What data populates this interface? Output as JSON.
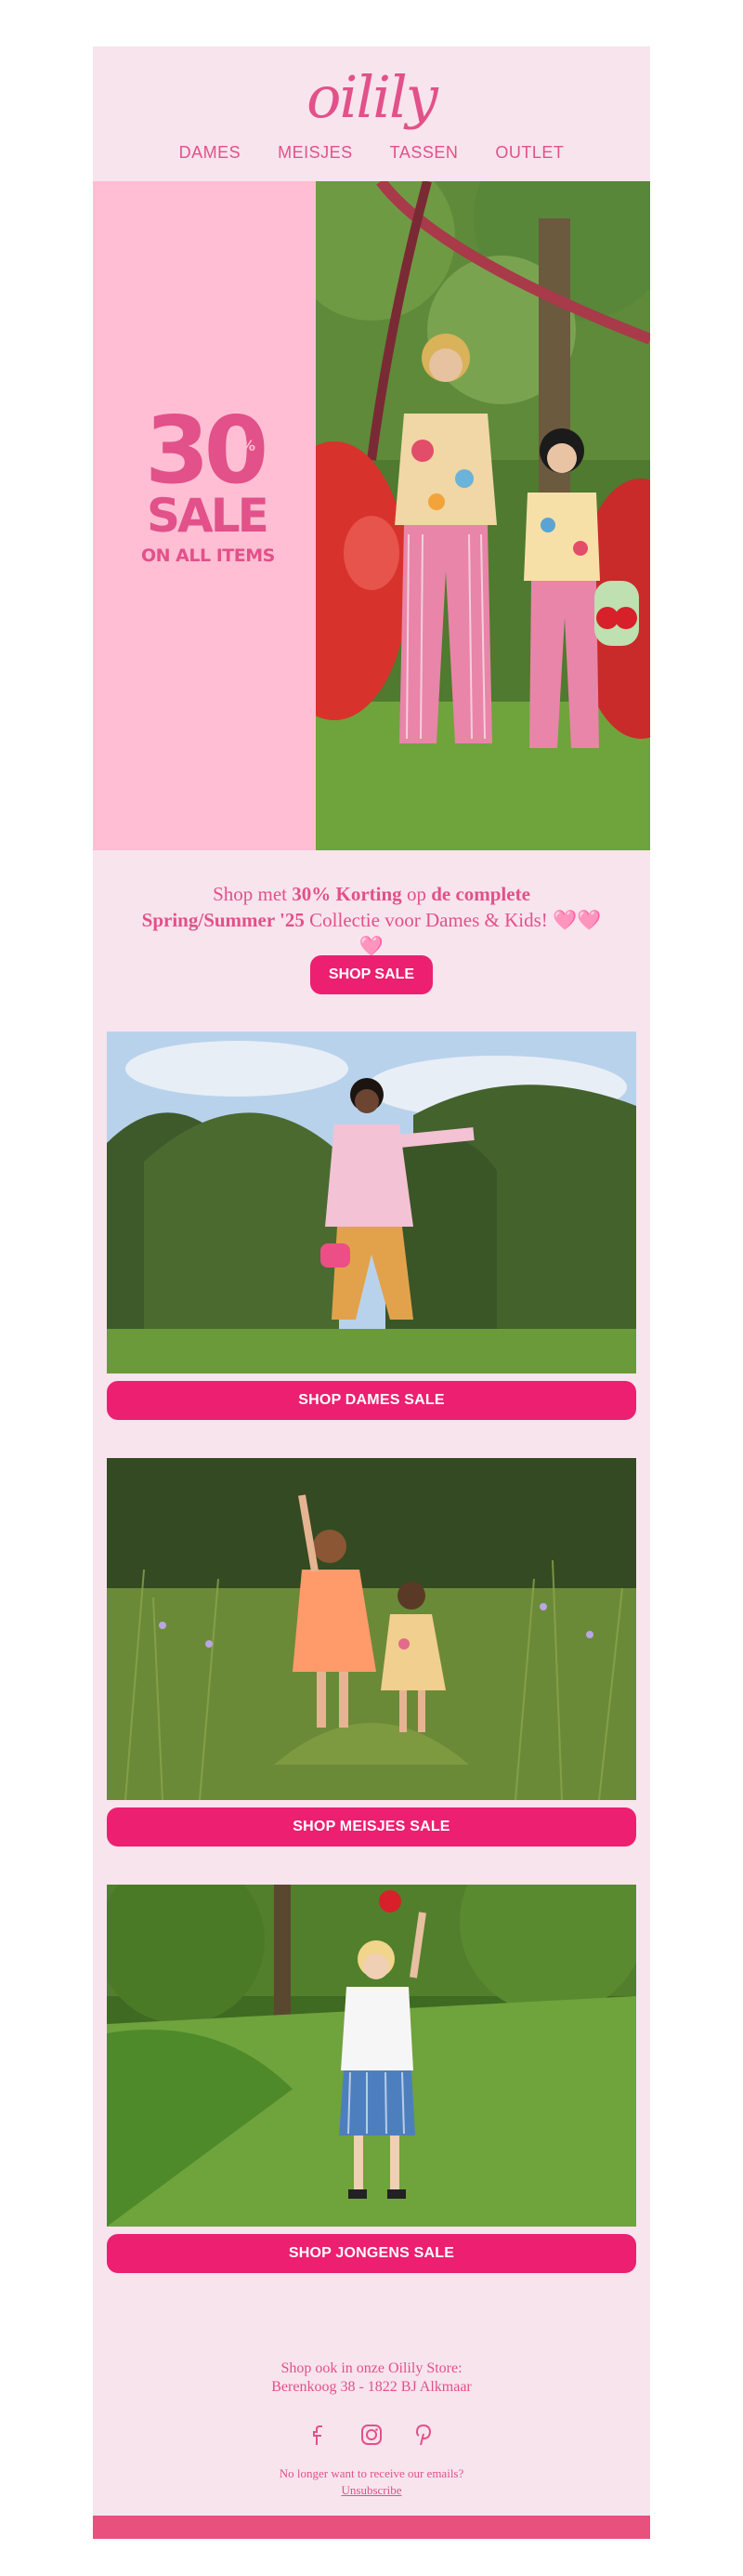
{
  "brand": {
    "logo_text": "oilily"
  },
  "nav": {
    "items": [
      "DAMES",
      "MEISJES",
      "TASSEN",
      "OUTLET"
    ]
  },
  "hero": {
    "percent_number": "30",
    "percent_sign": "%",
    "sale_word": "SALE",
    "subline": "ON ALL ITEMS"
  },
  "intro": {
    "part1": "Shop met ",
    "bold1": "30% Korting",
    "part2": " op ",
    "bold2": "de complete",
    "bold3": "Spring/Summer '25",
    "part3": " Collectie voor Dames & Kids! 🩷🩷🩷"
  },
  "buttons": {
    "shop_sale": "SHOP SALE",
    "dames": "SHOP DAMES SALE",
    "meisjes": "SHOP MEISJES SALE",
    "jongens": "SHOP JONGENS SALE"
  },
  "footer": {
    "store_line1": "Shop ook in onze Oilily Store:",
    "store_line2": "Berenkoog 38 - 1822 BJ Alkmaar",
    "social_icons": [
      "facebook-icon",
      "instagram-icon",
      "pinterest-icon"
    ],
    "unsubscribe_question": "No longer want to receive our emails?",
    "unsubscribe_link": "Unsubscribe"
  },
  "colors": {
    "background": "#f8e4ed",
    "accent_pink": "#e25189",
    "button_pink": "#ec1f70",
    "hero_pink": "#ffbed3",
    "footer_bar": "#e8517e"
  }
}
